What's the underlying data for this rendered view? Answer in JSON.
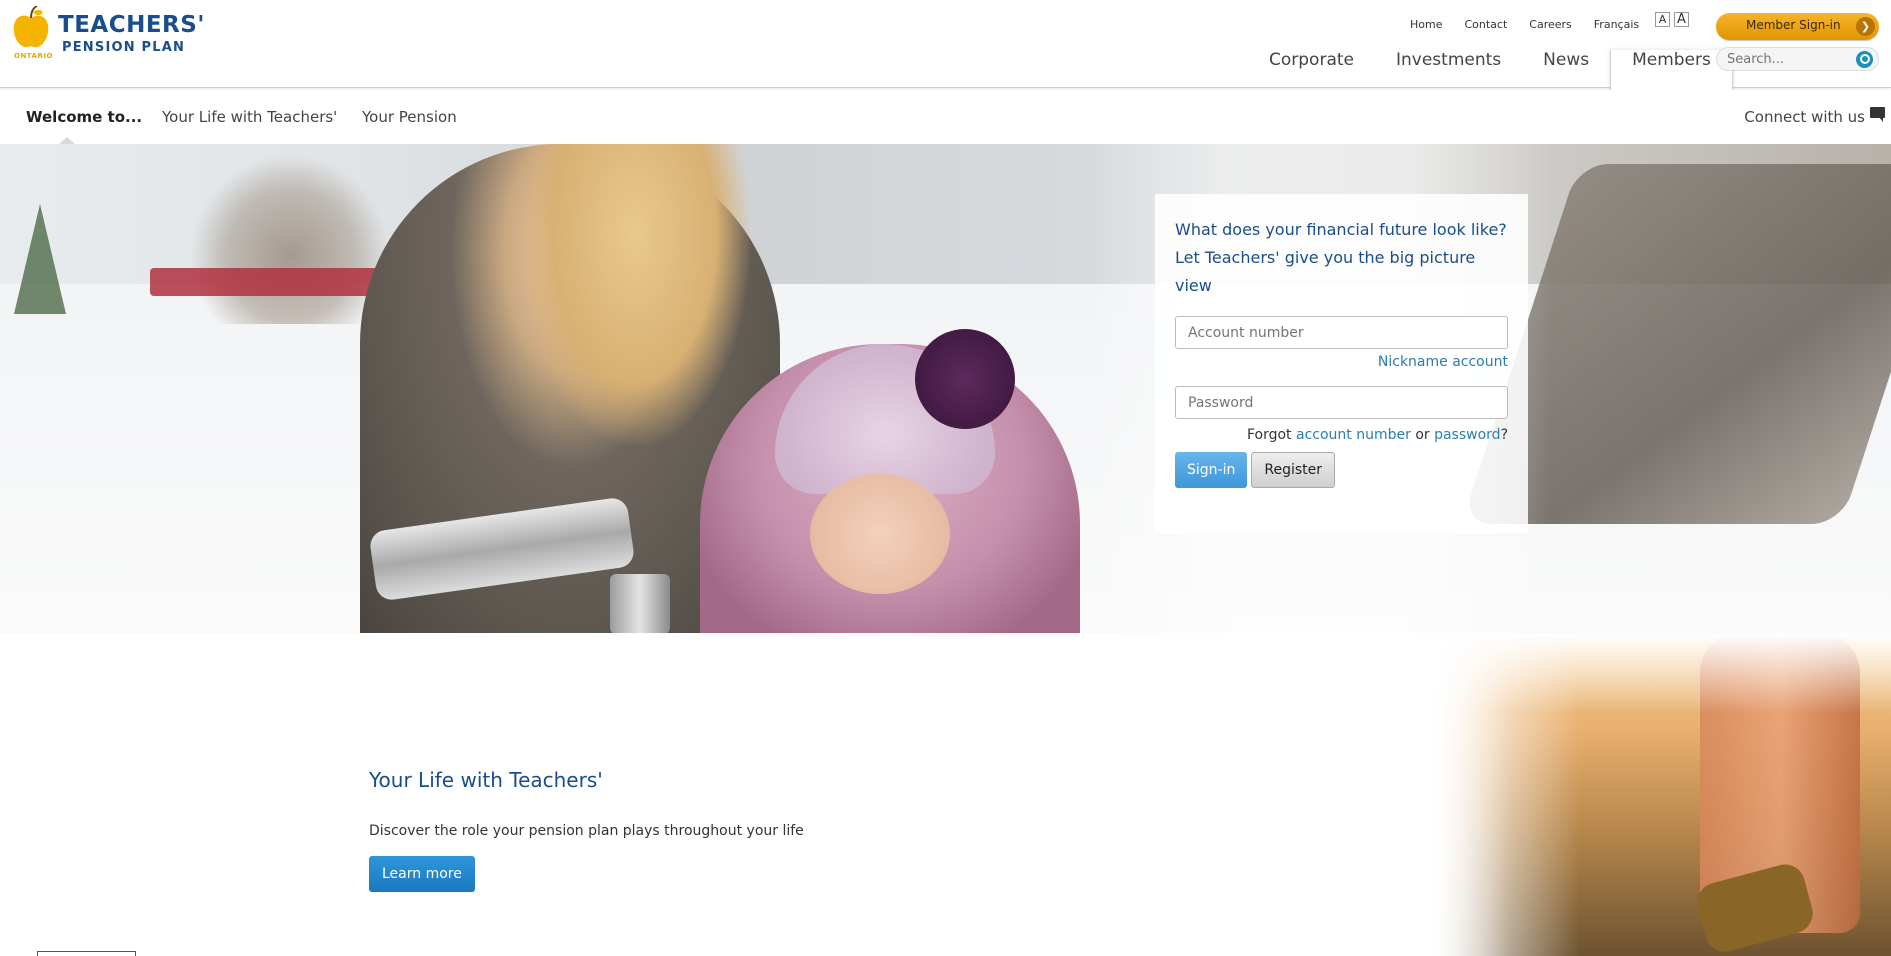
{
  "logo": {
    "teachers": "TEACHERS'",
    "pension_plan": "PENSION PLAN",
    "ontario": "ONTARIO"
  },
  "utility_nav": [
    "Home",
    "Contact",
    "Careers",
    "Français"
  ],
  "font_size": {
    "small": "A",
    "large": "A"
  },
  "member_signin": {
    "label": "Member Sign-in"
  },
  "main_nav": [
    {
      "label": "Corporate",
      "active": false
    },
    {
      "label": "Investments",
      "active": false
    },
    {
      "label": "News",
      "active": false
    },
    {
      "label": "Members",
      "active": true
    }
  ],
  "search": {
    "placeholder": "Search..."
  },
  "subnav": {
    "items": [
      "Welcome to...",
      "Your Life with Teachers'",
      "Your Pension"
    ],
    "connect": "Connect with us"
  },
  "login": {
    "tagline_1": "What does your financial future look like?",
    "tagline_2": "Let Teachers' give you the big picture view",
    "account_placeholder": "Account number",
    "nickname_link": "Nickname account",
    "password_placeholder": "Password",
    "forgot_prefix": "Forgot",
    "forgot_account": "account number",
    "forgot_or": "or",
    "forgot_password": "password",
    "forgot_suffix": "?",
    "signin_label": "Sign-in",
    "register_label": "Register"
  },
  "life_section": {
    "title": "Your Life with Teachers'",
    "description": "Discover the role your pension plan plays throughout your life",
    "button": "Learn more"
  },
  "colors": {
    "brand_blue": "#1a4d8c",
    "brand_gold": "#f7b52c",
    "link_blue": "#2d7bb2",
    "button_blue": "#1a78c0"
  }
}
